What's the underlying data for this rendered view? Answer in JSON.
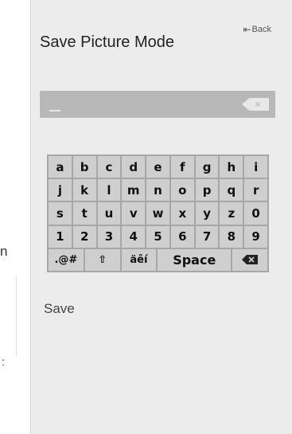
{
  "background": {
    "fragment_1": "n",
    "fragment_2": ":"
  },
  "header": {
    "back_label": "Back",
    "back_icon": "back-arrow-icon",
    "title": "Save Picture Mode"
  },
  "input": {
    "value": "",
    "clear_icon": "clear-icon"
  },
  "keyboard": {
    "rows": [
      [
        "a",
        "b",
        "c",
        "d",
        "e",
        "f",
        "g",
        "h",
        "i"
      ],
      [
        "j",
        "k",
        "l",
        "m",
        "n",
        "o",
        "p",
        "q",
        "r"
      ],
      [
        "s",
        "t",
        "u",
        "v",
        "w",
        "x",
        "y",
        "z",
        "0"
      ],
      [
        "1",
        "2",
        "3",
        "4",
        "5",
        "6",
        "7",
        "8",
        "9"
      ]
    ],
    "symbols_label": ".@#",
    "shift_icon": "shift-icon",
    "accents_label": "äêí",
    "space_label": "Space",
    "backspace_icon": "backspace-icon"
  },
  "actions": {
    "save_label": "Save"
  },
  "colors": {
    "panel": "#ececec",
    "input": "#b8b8b8",
    "keyboard": "#a7a7a7",
    "key": "#cfcfcf"
  }
}
